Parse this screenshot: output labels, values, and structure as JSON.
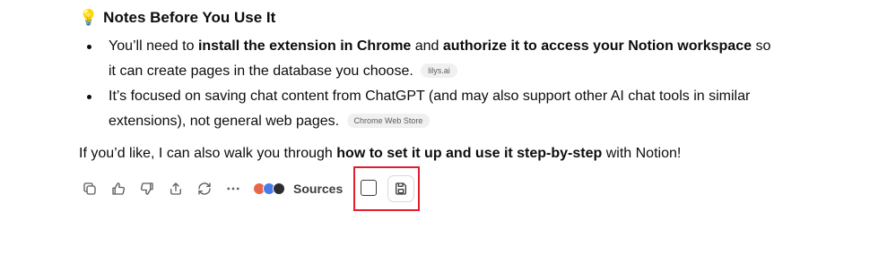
{
  "section": {
    "icon": "lightbulb-icon",
    "title": "Notes Before You Use It"
  },
  "bullets": [
    {
      "pre": "You’ll need to ",
      "bold1": "install the extension in Chrome",
      "mid": " and ",
      "bold2": "authorize it to access your Notion workspace",
      "post": " so it can create pages in the database you choose.",
      "chip": "lilys.ai"
    },
    {
      "text": "It’s focused on saving chat content from ChatGPT (and may also support other AI chat tools in similar extensions), not general web pages.",
      "chip": "Chrome Web Store"
    }
  ],
  "paragraph": {
    "pre": "If you’d like, I can also walk you through ",
    "bold": "how to set it up and use it step-by-step",
    "post": " with Notion!"
  },
  "actions": {
    "icons": [
      "copy-icon",
      "thumbs-up-icon",
      "thumbs-down-icon",
      "share-icon",
      "regenerate-icon",
      "more-icon"
    ],
    "sources_label": "Sources",
    "source_favicon_colors": [
      "#e8664a",
      "#4a7be8",
      "#2c2c2c"
    ]
  },
  "highlight_color": "#e11d2e"
}
